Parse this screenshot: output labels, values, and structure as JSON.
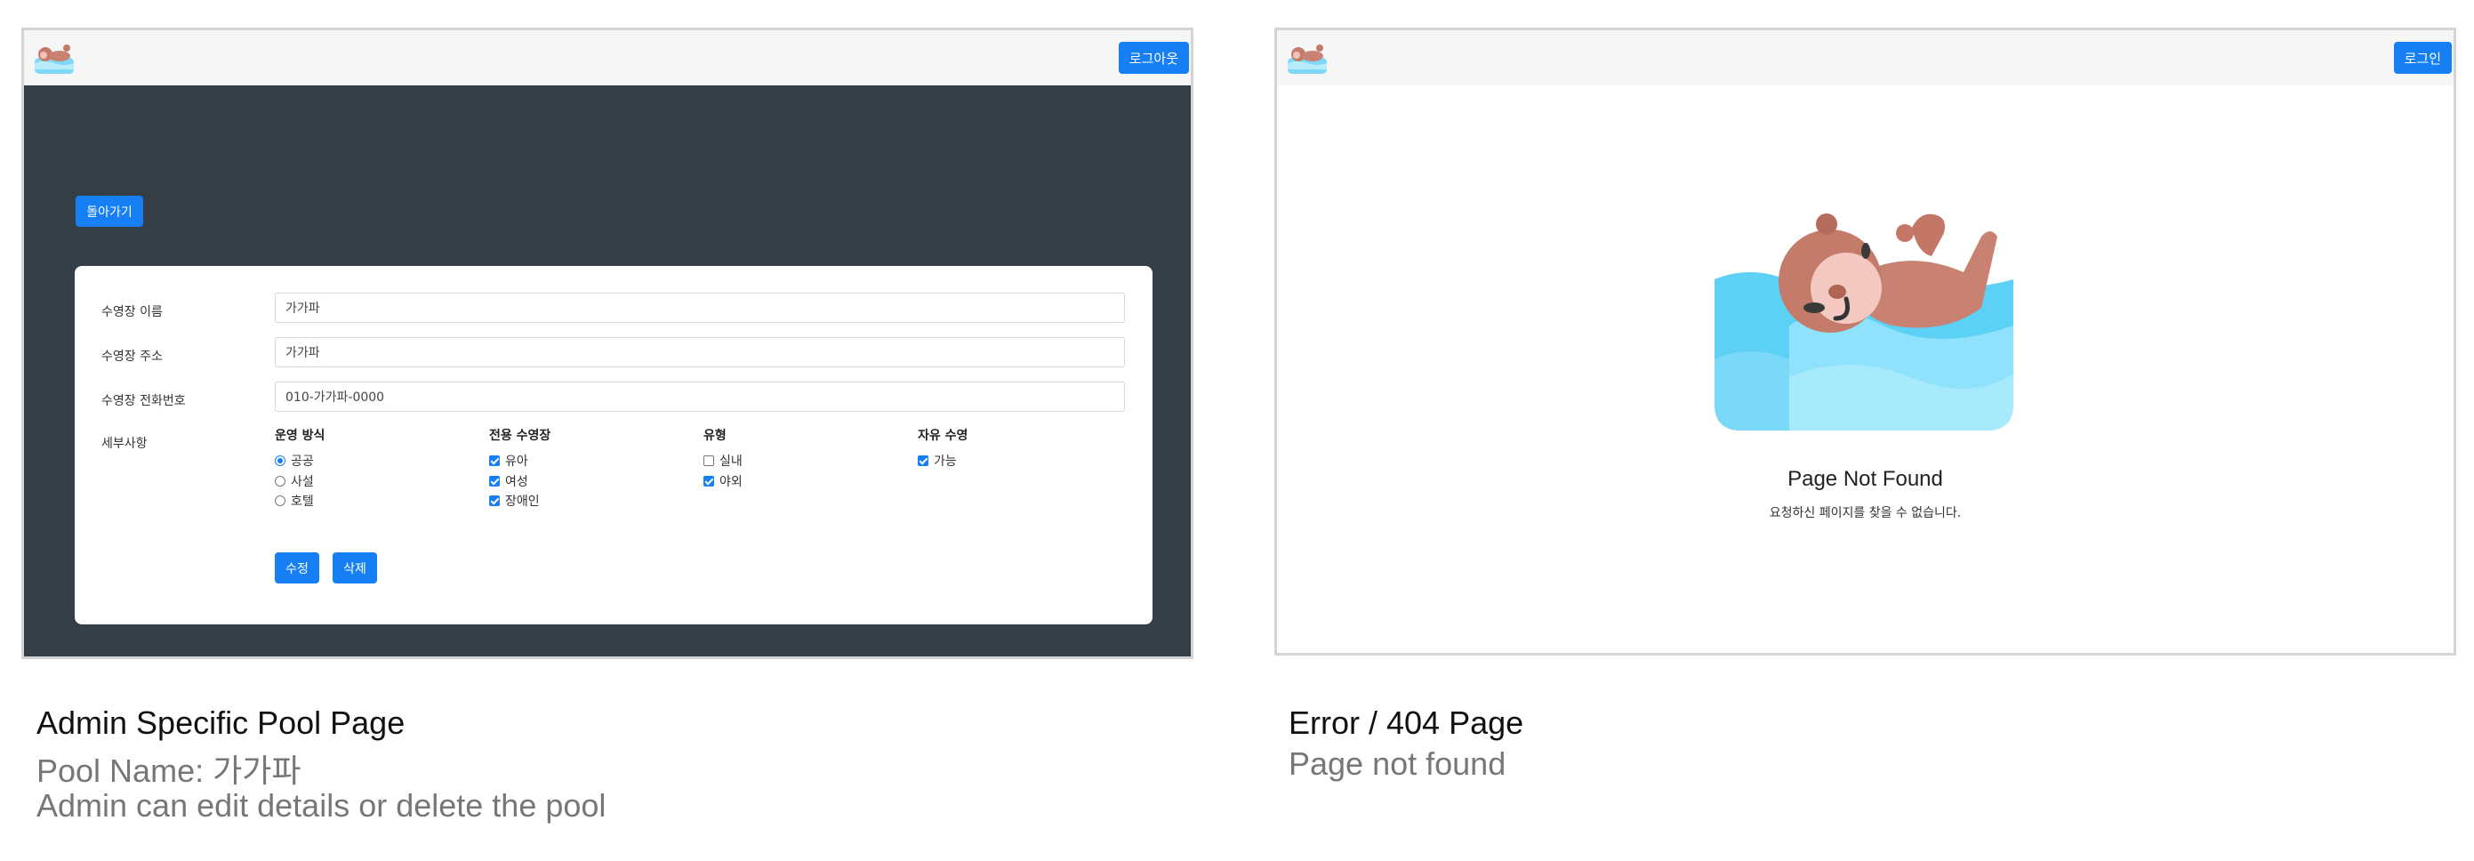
{
  "left_screen": {
    "header": {
      "logout_label": "로그아웃"
    },
    "back_label": "돌아가기",
    "form": {
      "name": {
        "label": "수영장 이름",
        "value": "가가파"
      },
      "address": {
        "label": "수영장 주소",
        "value": "가가파"
      },
      "phone": {
        "label": "수영장 전화번호",
        "value": "010-가가파-0000"
      },
      "details_label": "세부사항",
      "groups": {
        "operation": {
          "title": "운영 방식",
          "options": [
            "공공",
            "사설",
            "호텔"
          ],
          "selected": "공공"
        },
        "dedicated": {
          "title": "전용 수영장",
          "options": [
            "유아",
            "여성",
            "장애인"
          ],
          "checked": [
            true,
            true,
            true
          ]
        },
        "type": {
          "title": "유형",
          "options": [
            "실내",
            "야외"
          ],
          "checked": [
            false,
            true
          ]
        },
        "free_swim": {
          "title": "자유 수영",
          "options": [
            "가능"
          ],
          "checked": [
            true
          ]
        }
      },
      "edit_label": "수정",
      "delete_label": "삭제"
    }
  },
  "right_screen": {
    "header": {
      "login_label": "로그인"
    },
    "title": "Page Not Found",
    "message": "요청하신 페이지를 찾을 수 없습니다."
  },
  "captions": {
    "left": {
      "title": "Admin Specific Pool Page",
      "line1": "Pool Name: 가가파",
      "line2": "Admin can edit details or delete the pool"
    },
    "right": {
      "title": "Error / 404 Page",
      "line1": "Page not found"
    }
  },
  "colors": {
    "primary": "#157ff3",
    "dark_bg": "#353e45",
    "header_bg": "#f6f6f6"
  },
  "icons": {
    "logo": "otter-logo-icon",
    "illustration": "otter-swimming-illustration"
  }
}
